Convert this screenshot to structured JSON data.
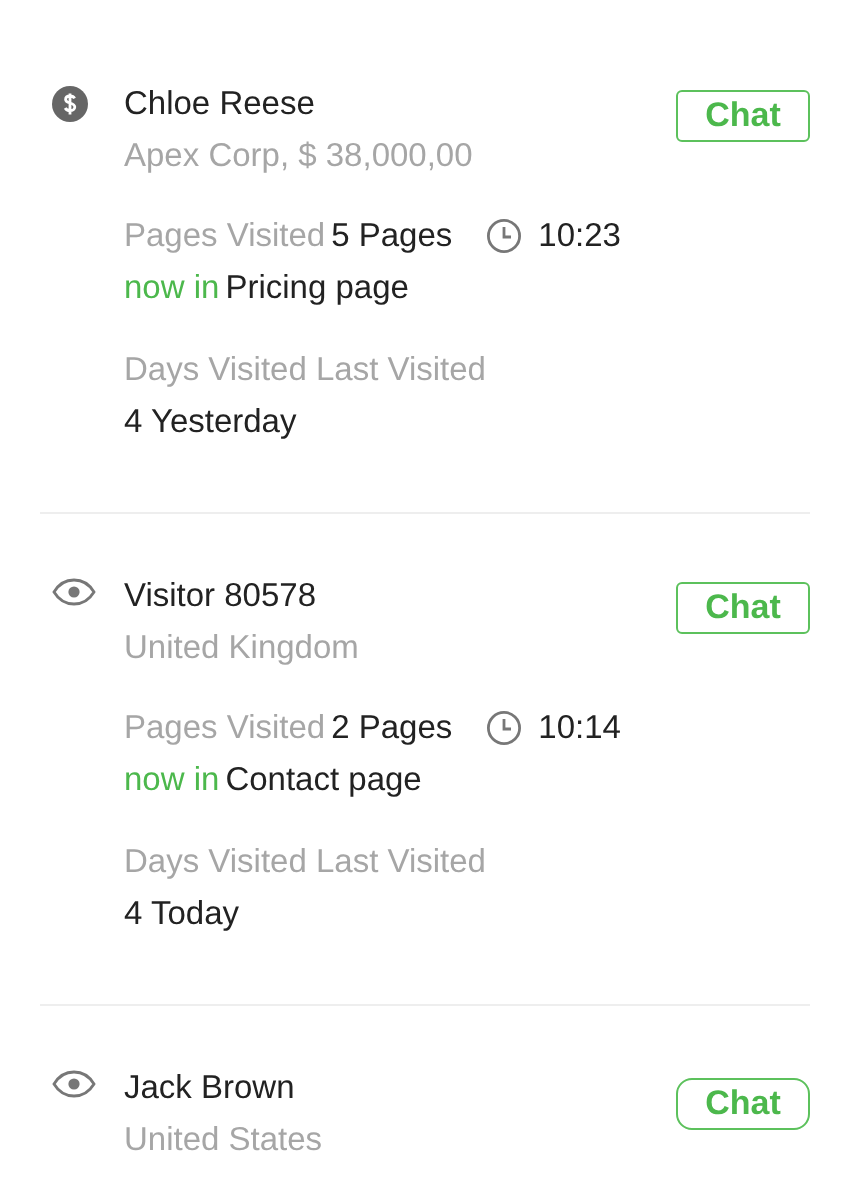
{
  "visitors": [
    {
      "kind": "paid",
      "name": "Chloe Reese",
      "subtitle": "Apex Corp, $ 38,000,00",
      "chat_label": "Chat",
      "details": {
        "pages_label": "Pages Visited",
        "pages_value": "5 Pages",
        "time": "10:23",
        "now_label": "now in",
        "now_page": "Pricing page",
        "days_header": "Days Visited Last Visited",
        "days_value": "4 Yesterday"
      }
    },
    {
      "kind": "visitor",
      "name": "Visitor 80578",
      "subtitle": "United Kingdom",
      "chat_label": "Chat",
      "details": {
        "pages_label": "Pages Visited",
        "pages_value": "2 Pages",
        "time": "10:14",
        "now_label": "now in",
        "now_page": "Contact page",
        "days_header": "Days Visited Last Visited",
        "days_value": "4 Today"
      }
    },
    {
      "kind": "visitor",
      "name": "Jack Brown",
      "subtitle": "United States",
      "chat_label": "Chat"
    }
  ]
}
